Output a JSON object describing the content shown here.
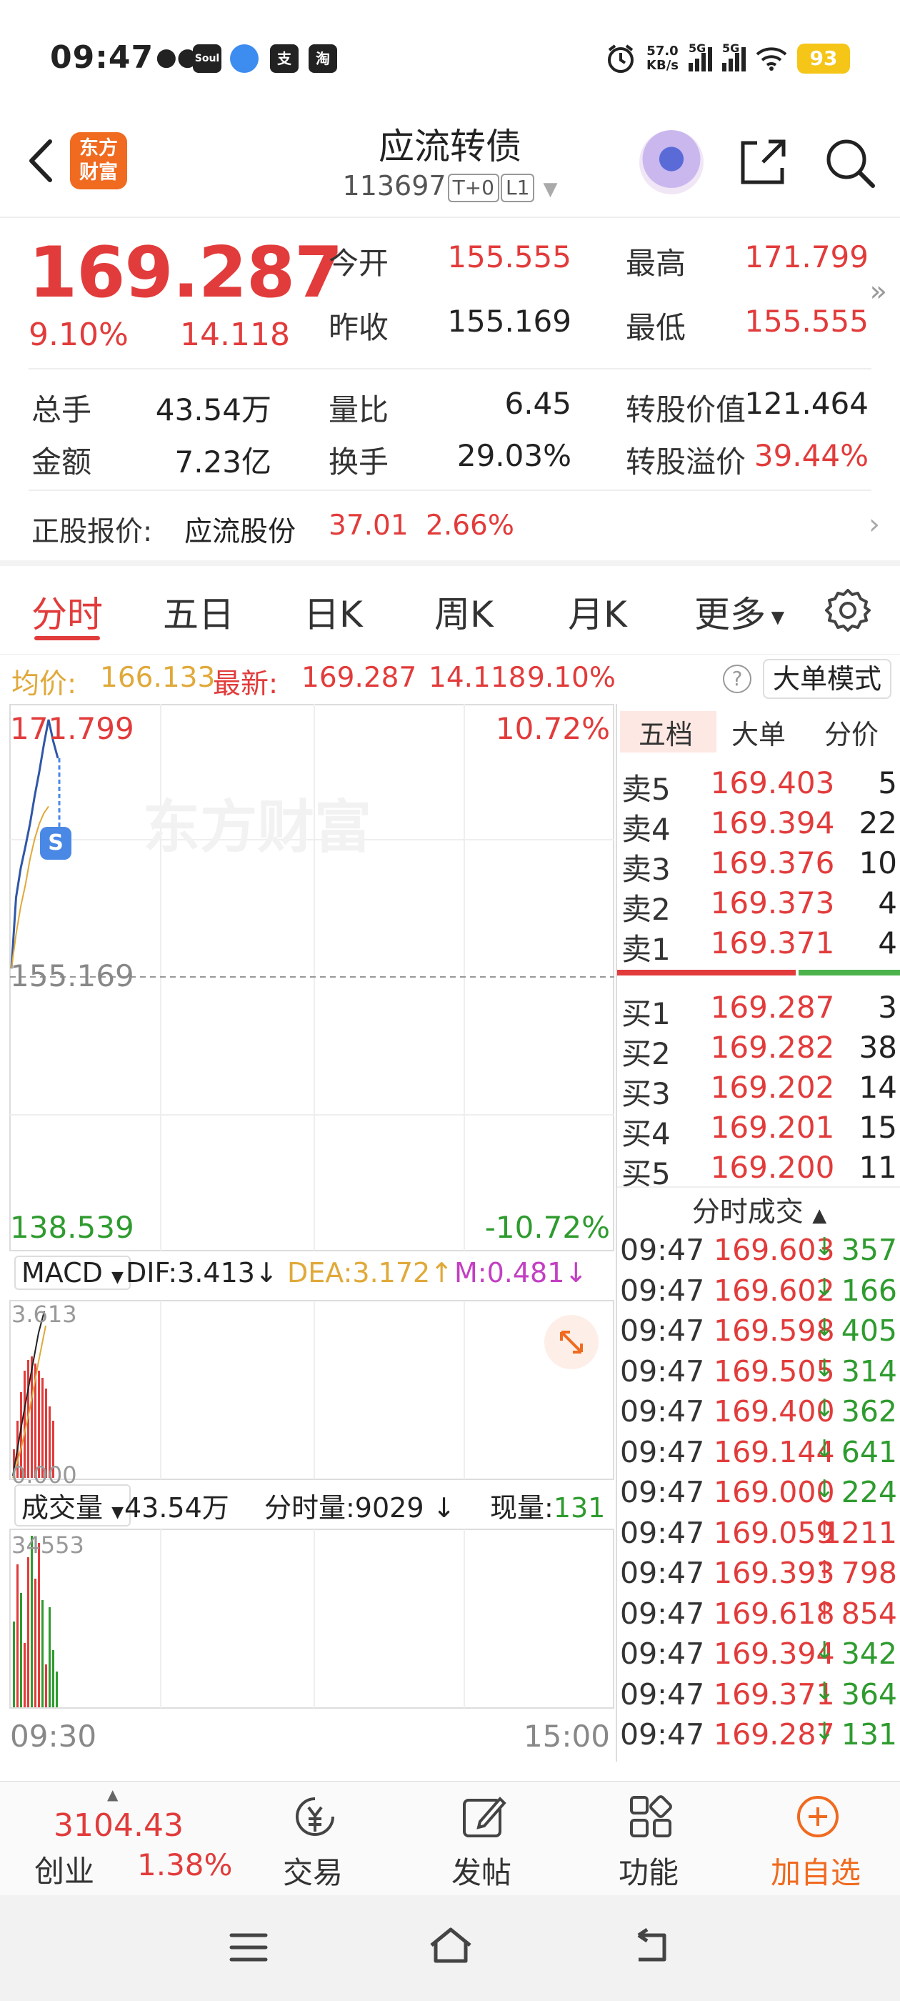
{
  "status_bar": {
    "time": "09:47",
    "app_icons": [
      "wechat-icon",
      "soul-icon",
      "app-icon",
      "alipay-icon",
      "taobao-icon"
    ],
    "net_speed_top": "57.0",
    "net_speed_bottom": "KB/s",
    "signal_label_1": "5G",
    "signal_label_2": "5G",
    "battery": "93"
  },
  "header": {
    "title": "应流转债",
    "code": "113697",
    "tag_t0": "T+0",
    "tag_l1": "L1"
  },
  "quote": {
    "last_price": "169.287",
    "change_pct": "9.10%",
    "change_amt": "14.118",
    "fields": [
      {
        "label": "今开",
        "value": "155.555",
        "color": "#e23b3b"
      },
      {
        "label": "最高",
        "value": "171.799",
        "color": "#e23b3b"
      },
      {
        "label": "昨收",
        "value": "155.169",
        "color": "#222222"
      },
      {
        "label": "最低",
        "value": "155.555",
        "color": "#e23b3b"
      },
      {
        "label": "总手",
        "value": "43.54万",
        "color": "#222222"
      },
      {
        "label": "量比",
        "value": "6.45",
        "color": "#222222"
      },
      {
        "label": "转股价值",
        "value": "121.464",
        "color": "#222222"
      },
      {
        "label": "金额",
        "value": "7.23亿",
        "color": "#222222"
      },
      {
        "label": "换手",
        "value": "29.03%",
        "color": "#222222"
      },
      {
        "label": "转股溢价",
        "value": "39.44%",
        "color": "#e23b3b"
      }
    ],
    "underlying_label": "正股报价:",
    "underlying_name": "应流股份",
    "underlying_price": "37.01",
    "underlying_pct": "2.66%"
  },
  "tabs": [
    "分时",
    "五日",
    "日K",
    "周K",
    "月K",
    "更多"
  ],
  "avg_row": {
    "avg_label": "均价:",
    "avg_value": "166.133",
    "latest_label": "最新:",
    "latest_value": "169.287",
    "latest_change": "14.118",
    "latest_pct": "9.10%",
    "big_order_mode": "大单模式"
  },
  "chart": {
    "high_label": "171.799",
    "high_pct": "10.72%",
    "mid_label": "155.169",
    "low_label": "138.539",
    "low_pct": "-10.72%",
    "watermark": "东方财富",
    "macd_label": "MACD",
    "dif": "DIF:3.413",
    "dif_arrow": "↓",
    "dea": "DEA:3.172",
    "dea_arrow": "↑",
    "m": "M:0.481",
    "m_arrow": "↓",
    "macd_top": "3.613",
    "macd_bottom": "0.000",
    "vol_label": "成交量",
    "vol_total": "43.54万",
    "vol_period": "分时量:9029",
    "vol_period_arrow": "↓",
    "vol_now_label": "现量:",
    "vol_now": "131",
    "vol_top": "34553",
    "time_start": "09:30",
    "time_end": "15:00"
  },
  "chart_data": {
    "type": "line",
    "ylim": [
      138.539,
      171.799
    ],
    "prev_close": 155.169,
    "time_range": [
      "09:30",
      "15:00"
    ],
    "price_line": [
      155.555,
      160.2,
      162.1,
      163.5,
      165.0,
      166.8,
      168.4,
      170.2,
      171.799,
      170.4,
      169.287
    ],
    "avg_line": [
      155.555,
      157.8,
      159.6,
      161.0,
      162.7,
      164.0,
      165.0,
      165.7,
      166.133
    ]
  },
  "orderbook": {
    "tabs": [
      "五档",
      "大单",
      "分价"
    ],
    "asks": [
      {
        "label": "卖5",
        "price": "169.403",
        "vol": "5"
      },
      {
        "label": "卖4",
        "price": "169.394",
        "vol": "22"
      },
      {
        "label": "卖3",
        "price": "169.376",
        "vol": "10"
      },
      {
        "label": "卖2",
        "price": "169.373",
        "vol": "4"
      },
      {
        "label": "卖1",
        "price": "169.371",
        "vol": "4"
      }
    ],
    "bids": [
      {
        "label": "买1",
        "price": "169.287",
        "vol": "3"
      },
      {
        "label": "买2",
        "price": "169.282",
        "vol": "38"
      },
      {
        "label": "买3",
        "price": "169.202",
        "vol": "14"
      },
      {
        "label": "买4",
        "price": "169.201",
        "vol": "15"
      },
      {
        "label": "买5",
        "price": "169.200",
        "vol": "11"
      }
    ],
    "trades_title": "分时成交",
    "trades": [
      {
        "time": "09:47",
        "price": "169.603",
        "dir": "↓",
        "vol": "357",
        "color": "#2e9b2e"
      },
      {
        "time": "09:47",
        "price": "169.602",
        "dir": "↓",
        "vol": "166",
        "color": "#2e9b2e"
      },
      {
        "time": "09:47",
        "price": "169.598",
        "dir": "↓",
        "vol": "405",
        "color": "#2e9b2e"
      },
      {
        "time": "09:47",
        "price": "169.505",
        "dir": "↓",
        "vol": "314",
        "color": "#2e9b2e"
      },
      {
        "time": "09:47",
        "price": "169.400",
        "dir": "↓",
        "vol": "362",
        "color": "#2e9b2e"
      },
      {
        "time": "09:47",
        "price": "169.144",
        "dir": "↓",
        "vol": "641",
        "color": "#2e9b2e"
      },
      {
        "time": "09:47",
        "price": "169.000",
        "dir": "↓",
        "vol": "224",
        "color": "#2e9b2e"
      },
      {
        "time": "09:47",
        "price": "169.059",
        "dir": "↑",
        "vol": "1211",
        "color": "#e23b3b"
      },
      {
        "time": "09:47",
        "price": "169.393",
        "dir": "↑",
        "vol": "798",
        "color": "#e23b3b"
      },
      {
        "time": "09:47",
        "price": "169.618",
        "dir": "↑",
        "vol": "854",
        "color": "#e23b3b"
      },
      {
        "time": "09:47",
        "price": "169.394",
        "dir": "↓",
        "vol": "342",
        "color": "#2e9b2e"
      },
      {
        "time": "09:47",
        "price": "169.371",
        "dir": "↓",
        "vol": "364",
        "color": "#2e9b2e"
      },
      {
        "time": "09:47",
        "price": "169.287",
        "dir": "↓",
        "vol": "131",
        "color": "#2e9b2e"
      }
    ]
  },
  "bottom_bar": {
    "index_value": "3104.43",
    "index_name": "创业",
    "index_pct": "1.38%",
    "items": [
      "交易",
      "发帖",
      "功能",
      "加自选"
    ]
  },
  "colors": {
    "up": "#e23b3b",
    "down": "#2e9b2e",
    "avg": "#e0a93a",
    "price_line": "#2f57a8",
    "accent": "#f06a1f"
  }
}
